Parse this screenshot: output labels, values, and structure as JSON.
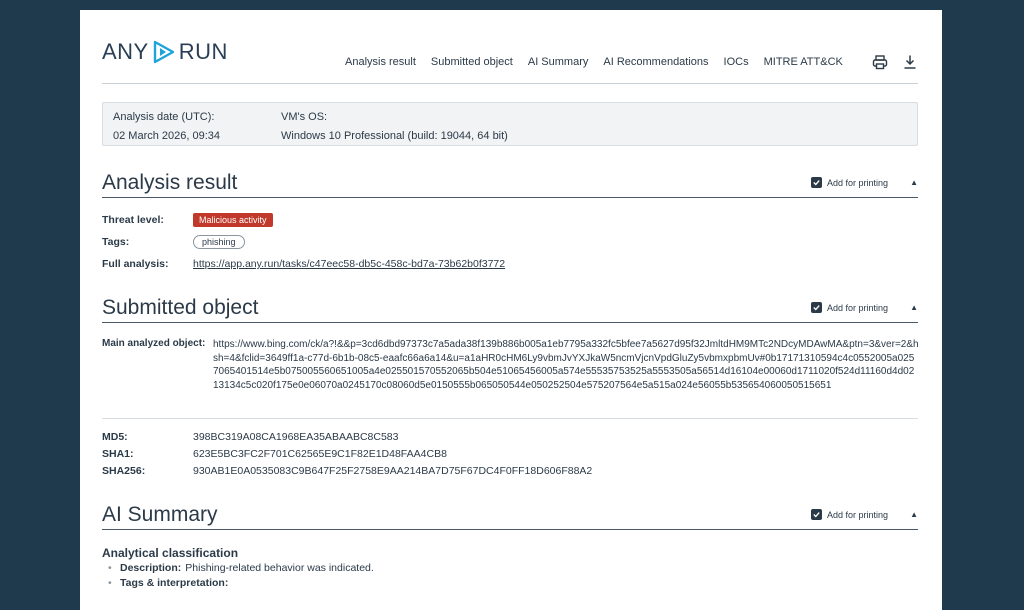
{
  "header": {
    "logo_left": "ANY",
    "logo_right": "RUN",
    "nav": [
      "Analysis result",
      "Submitted object",
      "AI Summary",
      "AI Recommendations",
      "IOCs",
      "MITRE ATT&CK"
    ],
    "icons": [
      "printer-icon",
      "download-icon"
    ]
  },
  "info": {
    "date_label": "Analysis date (UTC):",
    "date_value": "02 March 2026, 09:34",
    "os_label": "VM's OS:",
    "os_value": "Windows 10 Professional (build: 19044, 64 bit)"
  },
  "add_for_printing": "Add for printing",
  "analysis": {
    "title": "Analysis result",
    "threat_label": "Threat level:",
    "threat_value": "Malicious activity",
    "tags_label": "Tags:",
    "tag": "phishing",
    "full_label": "Full analysis:",
    "full_url": "https://app.any.run/tasks/c47eec58-db5c-458c-bd7a-73b62b0f3772"
  },
  "submitted": {
    "title": "Submitted object",
    "main_label": "Main analyzed object:",
    "main_value": "https://www.bing.com/ck/a?!&&p=3cd6dbd97373c7a5ada38f139b886b005a1eb7795a332fc5bfee7a5627d95f32JmltdHM9MTc2NDcyMDAwMA&ptn=3&ver=2&hsh=4&fclid=3649ff1a-c77d-6b1b-08c5-eaafc66a6a14&u=a1aHR0cHM6Ly9vbmJvYXJkaW5ncmVjcnVpdGluZy5vbmxpbmUv#0b17171310594c4c0552005a0257065401514e5b075005560651005a4e025501570552065b504e51065456005a574e55535753525a5553505a56514d16104e00060d1711020f524d11160d4d0213134c5c020f175e0e06070a0245170c08060d5e0150555b065050544e050252504e575207564e5a515a024e56055b535654060050515651",
    "md5_label": "MD5:",
    "md5": "398BC319A08CA1968EA35ABAABC8C583",
    "sha1_label": "SHA1:",
    "sha1": "623E5BC3FC2F701C62565E9C1F82E1D48FAA4CB8",
    "sha256_label": "SHA256:",
    "sha256": "930AB1E0A0535083C9B647F25F2758E9AA214BA7D75F67DC4F0FF18D606F88A2"
  },
  "ai": {
    "title": "AI Summary",
    "heading": "Analytical classification",
    "desc_label": "Description:",
    "desc_value": "Phishing-related behavior was indicated.",
    "tags_label": "Tags & interpretation:"
  }
}
